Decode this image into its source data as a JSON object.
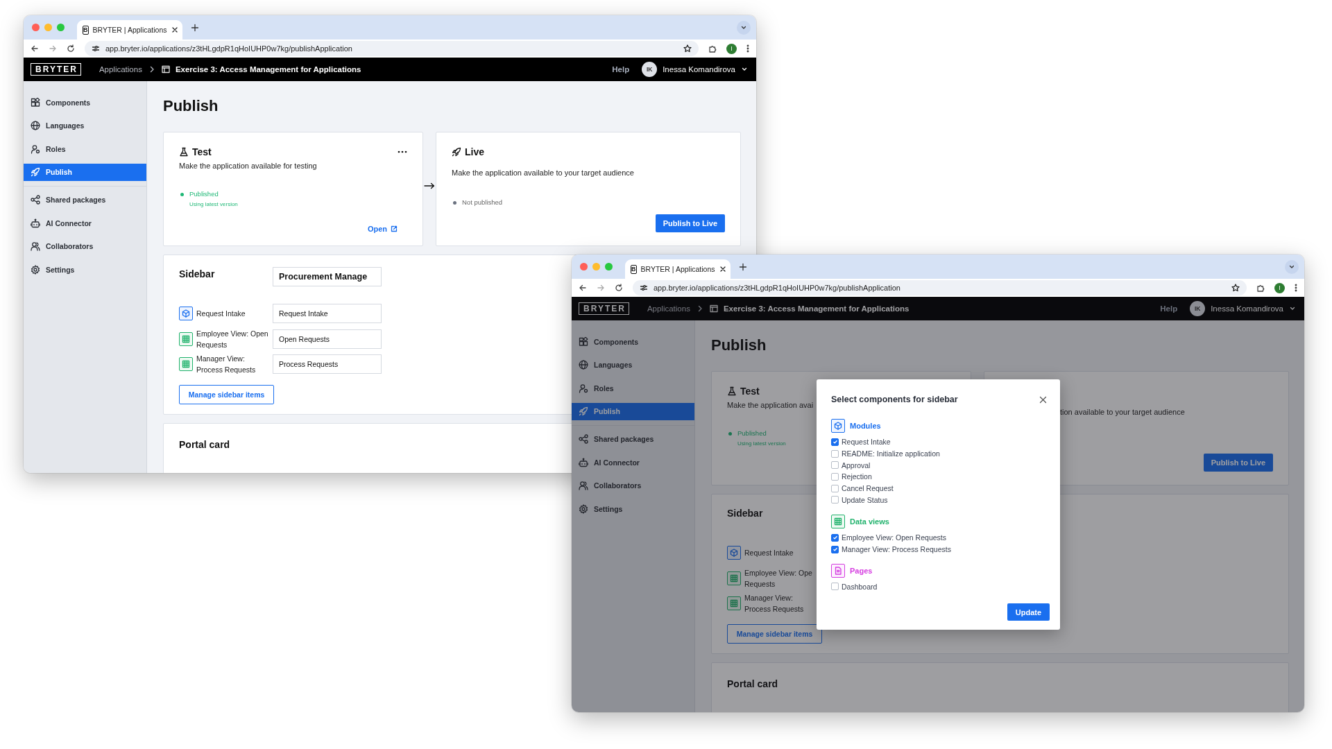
{
  "windows": [
    {
      "tab": {
        "favicon": "B",
        "title": "BRYTER | Applications"
      },
      "address": "app.bryter.io/applications/z3tHLgdpR1qHoIUHP0w7kg/publishApplication",
      "profile": "I",
      "header": {
        "logo": "BRYTER",
        "breadcrumb": "Applications",
        "app_title": "Exercise 3: Access Management for Applications",
        "help": "Help",
        "avatar": "IK",
        "user": "Inessa Komandirova"
      },
      "nav": [
        {
          "label": "Components",
          "selected": false
        },
        {
          "label": "Languages",
          "selected": false
        },
        {
          "label": "Roles",
          "selected": false
        },
        {
          "label": "Publish",
          "selected": true
        },
        {
          "label": "Shared packages",
          "selected": false
        },
        {
          "label": "AI Connector",
          "selected": false
        },
        {
          "label": "Collaborators",
          "selected": false
        },
        {
          "label": "Settings",
          "selected": false
        }
      ],
      "page_title": "Publish",
      "test_card": {
        "title": "Test",
        "menu": true,
        "description": "Make the application available for testing",
        "status": {
          "label": "Published",
          "kind": "published"
        },
        "note": "Using latest version",
        "link": "Open"
      },
      "flow_arrow": true,
      "live_card": {
        "title": "Live",
        "description": "Make the application available to your target audience",
        "status": {
          "label": "Not published",
          "kind": "unpublished"
        },
        "button": "Publish to Live"
      },
      "sidebar_card": {
        "title": "Sidebar",
        "name_field": "Procurement Manage",
        "items": [
          {
            "kind": "module",
            "label": "Request Intake",
            "value": "Request Intake"
          },
          {
            "kind": "data_view",
            "label": "Employee View: Open Requests",
            "value": "Open Requests"
          },
          {
            "kind": "data_view",
            "label": "Manager View: Process Requests",
            "value": "Process Requests"
          }
        ],
        "button": "Manage sidebar items"
      },
      "portal_card": {
        "title": "Portal card"
      }
    },
    {
      "tab": {
        "favicon": "B",
        "title": "BRYTER | Applications"
      },
      "address": "app.bryter.io/applications/z3tHLgdpR1qHoIUHP0w7kg/publishApplication",
      "profile": "I",
      "header": {
        "logo": "BRYTER",
        "breadcrumb": "Applications",
        "app_title": "Exercise 3: Access Management for Applications",
        "help": "Help",
        "avatar": "IK",
        "user": "Inessa Komandirova"
      },
      "nav": [
        {
          "label": "Components",
          "selected": false
        },
        {
          "label": "Languages",
          "selected": false
        },
        {
          "label": "Roles",
          "selected": false
        },
        {
          "label": "Publish",
          "selected": true
        },
        {
          "label": "Shared packages",
          "selected": false
        },
        {
          "label": "AI Connector",
          "selected": false
        },
        {
          "label": "Collaborators",
          "selected": false
        },
        {
          "label": "Settings",
          "selected": false
        }
      ],
      "page_title": "Publish",
      "test_card": {
        "title": "Test",
        "description": "Make the application avai",
        "status": {
          "label": "Published",
          "kind": "published"
        },
        "note": "Using latest version"
      },
      "live_card": {
        "description": "tion available to your target audience",
        "button": "Publish to Live"
      },
      "sidebar_card": {
        "title": "Sidebar",
        "items": [
          {
            "kind": "module",
            "label": "Request Intake"
          },
          {
            "kind": "data_view",
            "label": "Employee View: Ope Requests"
          },
          {
            "kind": "data_view",
            "label": "Manager View: Process Requests"
          }
        ],
        "button": "Manage sidebar items"
      },
      "portal_card": {
        "title": "Portal card"
      },
      "modal": {
        "title": "Select components for sidebar",
        "groups": [
          {
            "kind": "module",
            "label": "Modules",
            "items": [
              {
                "label": "Request Intake",
                "checked": true
              },
              {
                "label": "README: Initialize application",
                "checked": false
              },
              {
                "label": "Approval",
                "checked": false
              },
              {
                "label": "Rejection",
                "checked": false
              },
              {
                "label": "Cancel Request",
                "checked": false
              },
              {
                "label": "Update Status",
                "checked": false
              }
            ]
          },
          {
            "kind": "data_view",
            "label": "Data views",
            "items": [
              {
                "label": "Employee View: Open Requests",
                "checked": true
              },
              {
                "label": "Manager View: Process Requests",
                "checked": true
              }
            ]
          },
          {
            "kind": "page",
            "label": "Pages",
            "items": [
              {
                "label": "Dashboard",
                "checked": false
              }
            ]
          }
        ],
        "button": "Update"
      }
    }
  ]
}
